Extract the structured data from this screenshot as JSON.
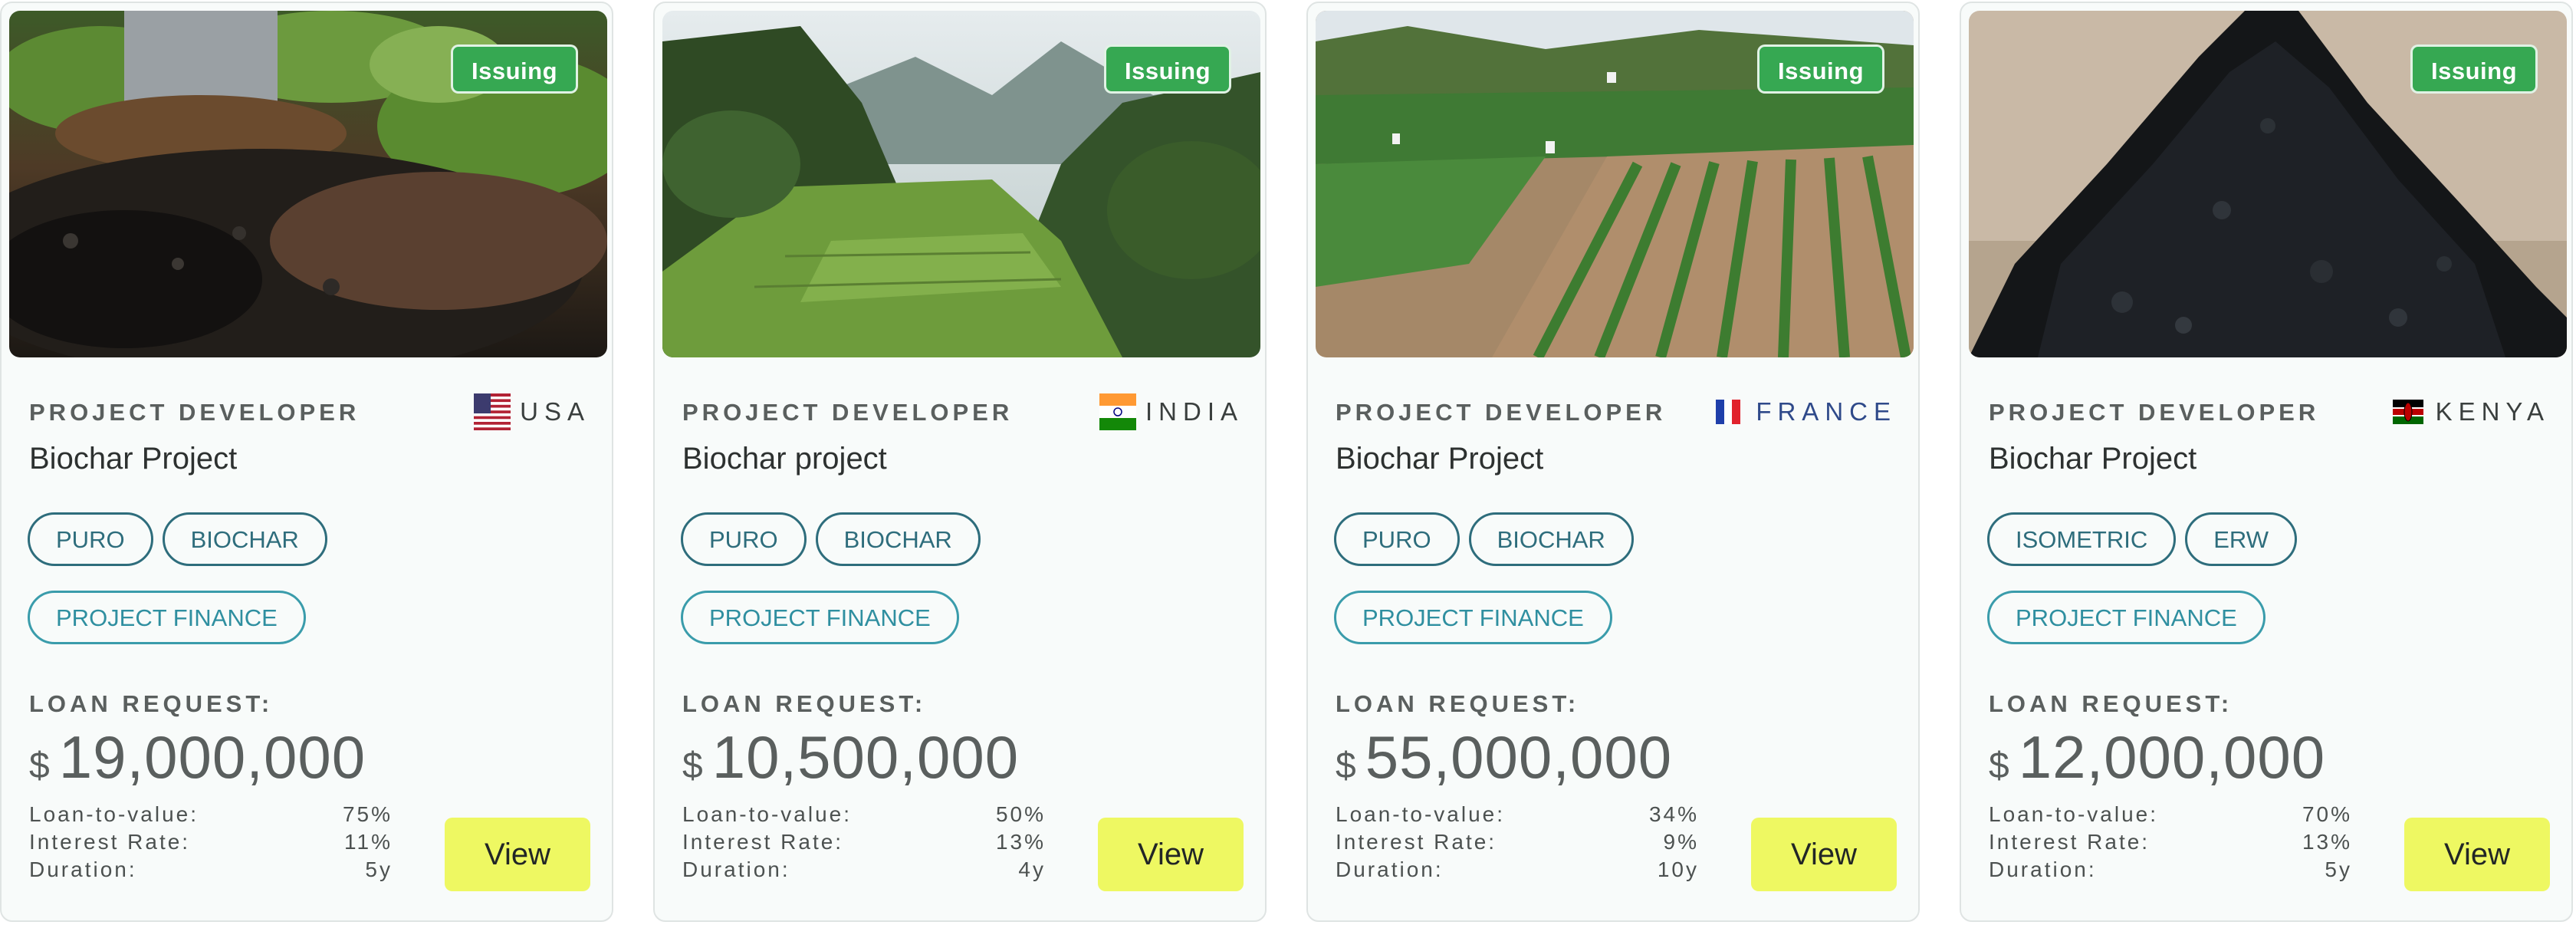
{
  "cards": [
    {
      "badge": "Issuing",
      "developer_label": "PROJECT DEVELOPER",
      "country": "USA",
      "flag_icon": "us-flag-icon",
      "project_name": "Biochar Project",
      "tags": [
        "PURO",
        "BIOCHAR",
        "PROJECT FINANCE"
      ],
      "loan_label": "LOAN REQUEST:",
      "currency": "$",
      "amount": "19,000,000",
      "stats": [
        {
          "label": "Loan-to-value:",
          "value": "75%"
        },
        {
          "label": "Interest Rate:",
          "value": "11%"
        },
        {
          "label": "Duration:",
          "value": "5y"
        }
      ],
      "view_label": "View"
    },
    {
      "badge": "Issuing",
      "developer_label": "PROJECT DEVELOPER",
      "country": "INDIA",
      "flag_icon": "india-flag-icon",
      "project_name": "Biochar project",
      "tags": [
        "PURO",
        "BIOCHAR",
        "PROJECT FINANCE"
      ],
      "loan_label": "LOAN REQUEST:",
      "currency": "$",
      "amount": "10,500,000",
      "stats": [
        {
          "label": "Loan-to-value:",
          "value": "50%"
        },
        {
          "label": "Interest Rate:",
          "value": "13%"
        },
        {
          "label": "Duration:",
          "value": "4y"
        }
      ],
      "view_label": "View"
    },
    {
      "badge": "Issuing",
      "developer_label": "PROJECT DEVELOPER",
      "country": "FRANCE",
      "flag_icon": "france-flag-icon",
      "project_name": "Biochar Project",
      "tags": [
        "PURO",
        "BIOCHAR",
        "PROJECT FINANCE"
      ],
      "loan_label": "LOAN REQUEST:",
      "currency": "$",
      "amount": "55,000,000",
      "stats": [
        {
          "label": "Loan-to-value:",
          "value": "34%"
        },
        {
          "label": "Interest Rate:",
          "value": "9%"
        },
        {
          "label": "Duration:",
          "value": "10y"
        }
      ],
      "view_label": "View"
    },
    {
      "badge": "Issuing",
      "developer_label": "PROJECT DEVELOPER",
      "country": "KENYA",
      "flag_icon": "kenya-flag-icon",
      "project_name": "Biochar Project",
      "tags": [
        "ISOMETRIC",
        "ERW",
        "PROJECT FINANCE"
      ],
      "loan_label": "LOAN REQUEST:",
      "currency": "$",
      "amount": "12,000,000",
      "stats": [
        {
          "label": "Loan-to-value:",
          "value": "70%"
        },
        {
          "label": "Interest Rate:",
          "value": "13%"
        },
        {
          "label": "Duration:",
          "value": "5y"
        }
      ],
      "view_label": "View"
    }
  ],
  "colors": {
    "badge": "#36a852",
    "view_button": "#eef862",
    "tag_border": "#2e6d7c",
    "finance_tag": "#3a9cab"
  }
}
